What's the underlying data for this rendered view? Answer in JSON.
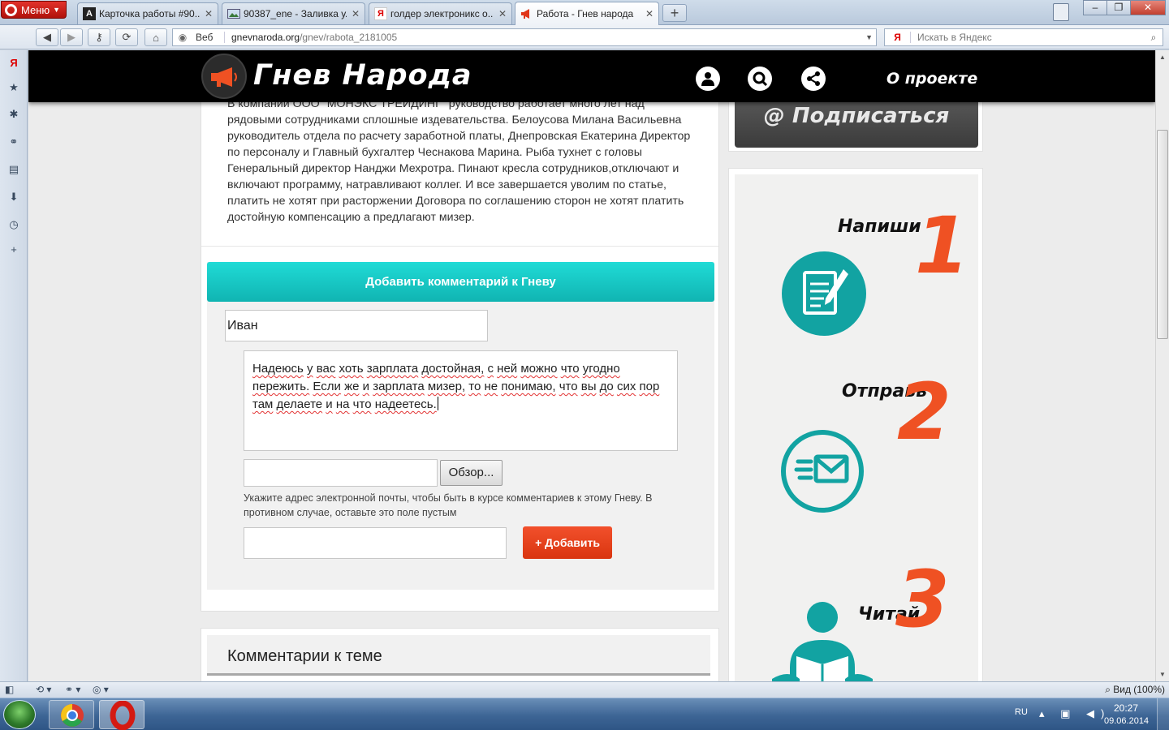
{
  "browser": {
    "menu_label": "Меню",
    "tabs": [
      {
        "title": "Карточка работы #90...",
        "favicon": "A"
      },
      {
        "title": "90387_ene - Заливка у...",
        "favicon": "img"
      },
      {
        "title": "голдер электроникс о...",
        "favicon": "Я"
      },
      {
        "title": "Работа - Гнев народа",
        "favicon": "megaphone"
      }
    ],
    "address": {
      "web_label": "Веб",
      "url_host": "gnevnaroda.org",
      "url_path": "/gnev/rabota_2181005"
    },
    "search": {
      "engine": "Я",
      "placeholder": "Искать в Яндекс"
    },
    "status": {
      "zoom_label": "Вид (100%)"
    }
  },
  "site": {
    "title": "Гнев Народа",
    "about_label": "О проекте",
    "header_icons": [
      "user-icon",
      "search-icon",
      "share-icon"
    ],
    "accent_color": "#ef5123",
    "teal_color": "#12b9b5"
  },
  "article": {
    "text": "В компании ООО \"МОНЭКС ТРЕЙДИНГ\" руководство работает много лет над рядовыми сотрудниками сплошные издевательства. Белоусова Милана Васильевна руководитель отдела по расчету заработной платы, Днепровская Екатерина Директор по персоналу и Главный бухгалтер Чеснакова Марина. Рыба тухнет с головы Генеральный директор Нанджи Мехротра. Пинают кресла сотрудников,отключают и включают программу, натравливают коллег. И все завершается уволим по статье, платить не хотят при расторжении Договора по соглашению сторон не хотят платить достойную компенсацию а предлагают мизер."
  },
  "comment_form": {
    "header": "Добавить комментарий к Гневу",
    "name_value": "Иван",
    "comment_words": [
      "Надеюсь",
      "у",
      "вас",
      "хоть",
      "зарплата",
      "достойная,",
      "с",
      "ней",
      "можно",
      "что",
      "угодно",
      "пережить.",
      "Если",
      "же",
      "и",
      "зарплата",
      "мизер,",
      "то",
      "не",
      "понимаю,",
      "что",
      "вы",
      "до",
      "сих",
      "пор",
      "там",
      "делаете",
      "и",
      "на",
      "что",
      "надеетесь."
    ],
    "browse_label": "Обзор...",
    "email_hint": "Укажите адрес электронной почты, чтобы быть в курсе комментариев к этому Гневу. В противном случае, оставьте это поле пустым",
    "add_label": "+ Добавить"
  },
  "comments": {
    "heading": "Комментарии к теме"
  },
  "sidebar": {
    "subscribe_label": "@ Подписаться",
    "steps": [
      {
        "label": "Напиши",
        "number": "1",
        "icon": "document-pen-icon"
      },
      {
        "label": "Отправь",
        "number": "2",
        "icon": "envelope-icon"
      },
      {
        "label": "Читай",
        "number": "3",
        "icon": "reader-icon"
      }
    ]
  },
  "taskbar": {
    "lang": "RU",
    "time": "20:27",
    "date": "09.06.2014"
  }
}
